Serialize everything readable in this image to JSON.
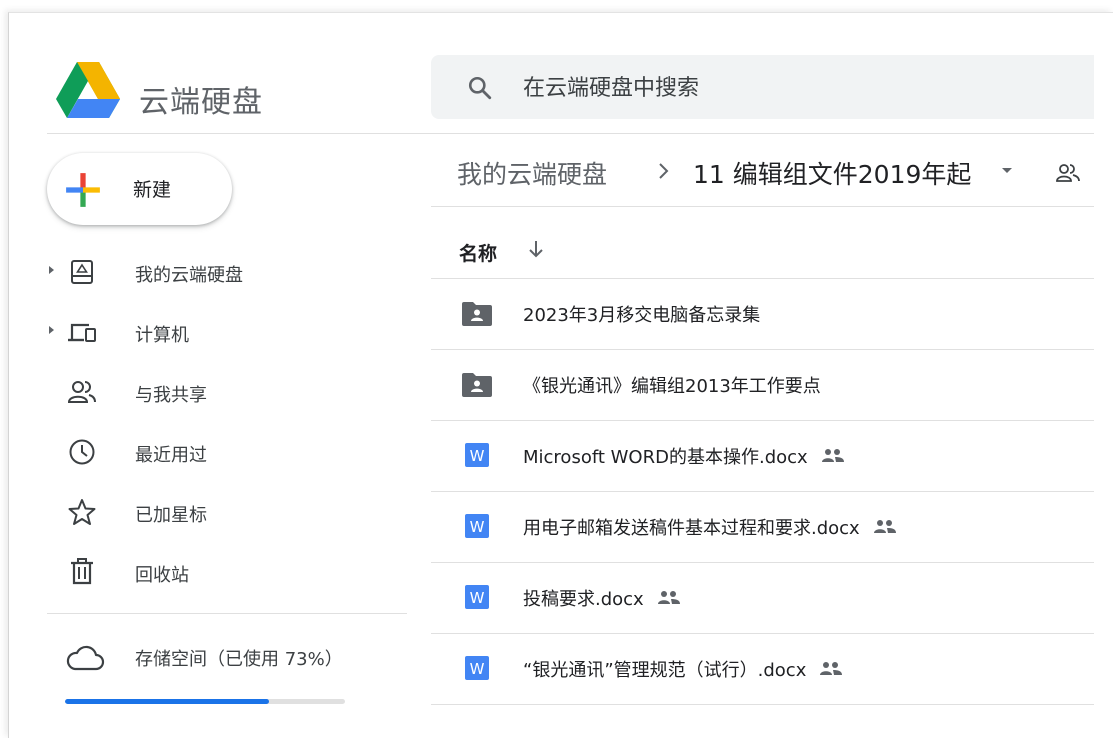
{
  "app": {
    "title": "云端硬盘"
  },
  "search": {
    "placeholder": "在云端硬盘中搜索"
  },
  "new_button": {
    "label": "新建"
  },
  "sidebar": {
    "items": [
      {
        "label": "我的云端硬盘",
        "icon": "my-drive-icon",
        "expandable": true
      },
      {
        "label": "计算机",
        "icon": "computers-icon",
        "expandable": true
      },
      {
        "label": "与我共享",
        "icon": "shared-with-me-icon",
        "expandable": false
      },
      {
        "label": "最近用过",
        "icon": "clock-icon",
        "expandable": false
      },
      {
        "label": "已加星标",
        "icon": "star-icon",
        "expandable": false
      },
      {
        "label": "回收站",
        "icon": "trash-icon",
        "expandable": false
      }
    ]
  },
  "storage": {
    "label": "存储空间（已使用 73%）",
    "used_fraction": 0.73,
    "icon": "cloud-icon"
  },
  "breadcrumb": {
    "root": "我的云端硬盘",
    "current": "11 编辑组文件2019年起"
  },
  "file_list": {
    "name_header": "名称",
    "sort_direction": "descending",
    "rows": [
      {
        "name": "2023年3月移交电脑备忘录集",
        "type": "shared-folder",
        "shared": false
      },
      {
        "name": "《银光通讯》编辑组2013年工作要点",
        "type": "shared-folder",
        "shared": false
      },
      {
        "name": "Microsoft WORD的基本操作.docx",
        "type": "word",
        "shared": true
      },
      {
        "name": "用电子邮箱发送稿件基本过程和要求.docx",
        "type": "word",
        "shared": true
      },
      {
        "name": "投稿要求.docx",
        "type": "word",
        "shared": true
      },
      {
        "name": "“银光通讯”管理规范（试行）.docx",
        "type": "word",
        "shared": true
      }
    ]
  },
  "colors": {
    "accent": "#1a73e8",
    "word_blue": "#4285f4",
    "folder_gray": "#5f6368",
    "drive_green": "#0f9d58",
    "drive_yellow": "#f4b400",
    "drive_blue": "#4285f4"
  }
}
